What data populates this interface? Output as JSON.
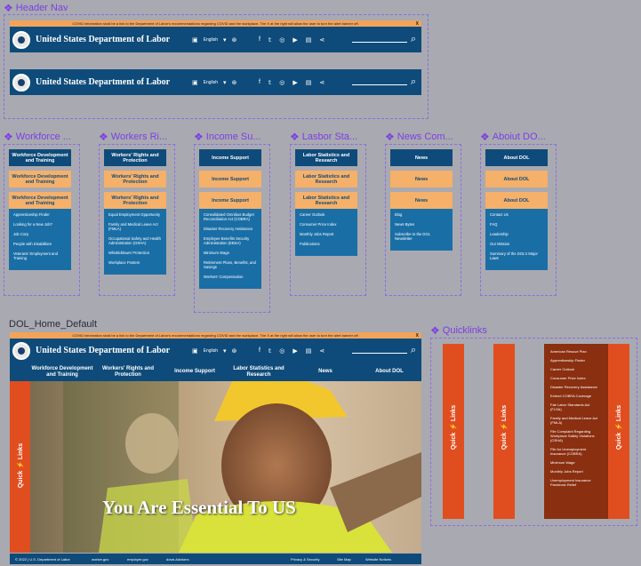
{
  "labels": {
    "header_nav": "Header Nav",
    "workforce": "Workforce ...",
    "workers": "Workers Ri...",
    "income": "Income Su...",
    "labor": "Lasbor Sta...",
    "news": "News Com...",
    "about": "Aboiut DO...",
    "home_default": "DOL_Home_Default",
    "quicklinks": "Quicklinks"
  },
  "alert": {
    "text": "COVID information shall be a link to the Department of Labor's recommendations regarding COVID and the workplace. The X at the right will allow the user to turn the alert banner off.",
    "close": "X"
  },
  "header": {
    "title": "United States Department of Labor",
    "language": "English",
    "language_chevron": "▾"
  },
  "menus": [
    {
      "head": "Workforce Development and Training",
      "hovers": [
        "Workforce Development and Training",
        "Workforce Development and Training"
      ],
      "items": [
        "Apprenticeship Finder",
        "Looking for a New Job?",
        "Job Corp",
        "People with Disabilities",
        "Veterans' Employment and Training"
      ]
    },
    {
      "head": "Workers' Rights and Protection",
      "hovers": [
        "Workers' Rights and Protection",
        "Workers' Rights and Protection"
      ],
      "items": [
        "Equal Employment Opportunity",
        "Family and Medical Leave Act (FMLA)",
        "Occupational Safety and Health Administration (OSHA)",
        "Whistleblower Protection",
        "Workplace Posters"
      ]
    },
    {
      "head": "Income Support",
      "hovers": [
        "Income Support",
        "Income Support"
      ],
      "items": [
        "Consolidated Omnibus Budget Reconciliation Act (COBRA)",
        "Disaster Recovery Assistance",
        "Employee Benefits Security Administration (EBSA)",
        "Minimum Wage",
        "Retirement Plans, Benefits, and Savings",
        "Workers' Compensation"
      ]
    },
    {
      "head": "Labor Statistics and Research",
      "hovers": [
        "Labor Statistics and Research",
        "Labor Statistics and Research"
      ],
      "items": [
        "Career Outlook",
        "Consumer Price Index",
        "Monthly Jobs Report",
        "Publications"
      ]
    },
    {
      "head": "News",
      "hovers": [
        "News",
        "News"
      ],
      "items": [
        "Blog",
        "News Bytes",
        "Subscribe to the DOL Newsletter"
      ]
    },
    {
      "head": "About DOL",
      "hovers": [
        "About DOL",
        "About DOL"
      ],
      "items": [
        "Contact Us",
        "FAQ",
        "Leadership",
        "Our Mission",
        "Summary of the DOL's Major Laws"
      ]
    }
  ],
  "nav": [
    "Workforce Development and Training",
    "Workers' Rights and Protection",
    "Income Support",
    "Labor Statistics and Research",
    "News",
    "About DOL"
  ],
  "hero": {
    "headline": "You Are Essential To US",
    "quick_tab": "Quick  ⚡  Links"
  },
  "footer": {
    "copyright": "© 2022 | U.S. Department of Labor",
    "links": [
      "worker.gov",
      "employer.gov",
      "dows Advisers"
    ],
    "right_links": [
      "Privacy & Security",
      "Site Map",
      "Website Notices"
    ]
  },
  "quicklinks": {
    "tab_label": "Quick  ⚡  Links",
    "items": [
      "American Rescue Plan",
      "Apprenticeship Finder",
      "Career Outlook",
      "Consumer Price Index",
      "Disaster Recovery Assistance",
      "Extend COBRA Coverage",
      "Fair Labor Standards Act (FLSA)",
      "Family and Medical Leave Act (FMLA)",
      "File Complaint Regarding Workplace Safety Violations (OSHA)",
      "File for Unemployment Insurance (COBRA)",
      "Minimum Wage",
      "Monthly Jobs Report",
      "Unemployment Insurance Pandemic Relief"
    ]
  },
  "colors": {
    "navy": "#0e4b7a",
    "orange": "#e04e1f",
    "alert": "#f2a35a",
    "hover": "#f5b06a"
  }
}
